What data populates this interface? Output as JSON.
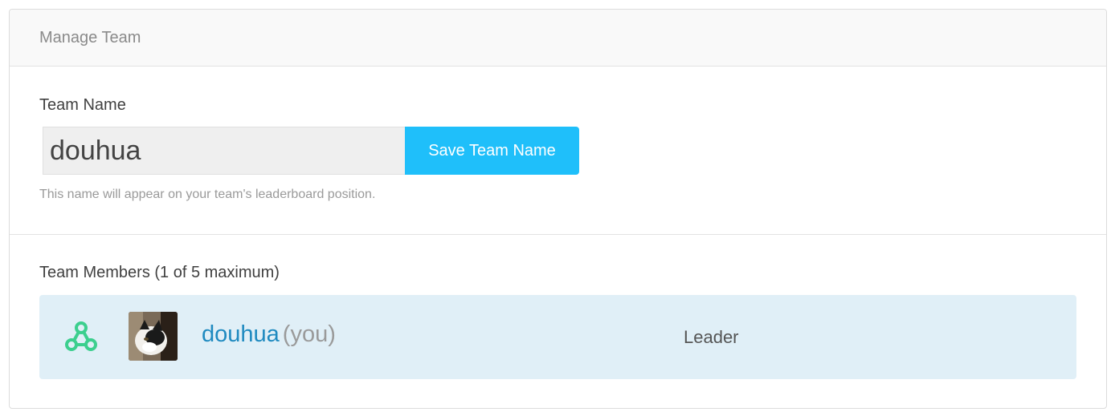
{
  "panel": {
    "title": "Manage Team"
  },
  "team_name": {
    "label": "Team Name",
    "value": "douhua",
    "save_label": "Save Team Name",
    "help": "This name will appear on your team's leaderboard position."
  },
  "members": {
    "heading": "Team Members (1 of 5 maximum)",
    "list": [
      {
        "icon": "team-leader-icon",
        "name": "douhua",
        "suffix": "(you)",
        "role": "Leader"
      }
    ]
  },
  "colors": {
    "accent": "#1fbffa",
    "member_bg": "#e0eff7",
    "icon_green": "#3ccf8e",
    "name_link": "#1f8ac0"
  }
}
